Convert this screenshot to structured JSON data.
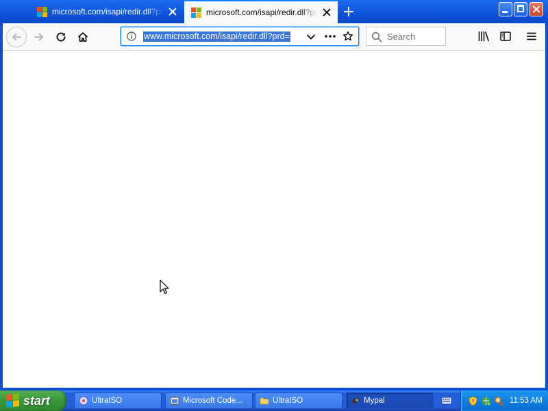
{
  "browser": {
    "tabs": [
      {
        "title": "microsoft.com/isapi/redir.dll?prd=",
        "active": false
      },
      {
        "title": "microsoft.com/isapi/redir.dll?prd=",
        "active": true
      }
    ],
    "url": "www.microsoft.com/isapi/redir.dll?prd=",
    "search_placeholder": "Search",
    "colors": {
      "tabbar": "#0b4fd4",
      "url_highlight": "#3b74d8",
      "focus_ring": "#0a84ff"
    },
    "icons": [
      "back-arrow-icon",
      "forward-arrow-icon",
      "reload-icon",
      "home-icon",
      "info-icon",
      "chevron-down-icon",
      "more-dots-icon",
      "bookmark-star-icon",
      "search-icon",
      "library-icon",
      "sidebar-icon",
      "hamburger-menu-icon"
    ]
  },
  "taskbar": {
    "start_label": "start",
    "items": [
      {
        "label": "UltraISO",
        "icon": "ultraiso-disc-icon"
      },
      {
        "label": "Microsoft Code...",
        "icon": "installer-icon"
      },
      {
        "label": "UltraISO",
        "icon": "folder-icon"
      },
      {
        "label": "Mypal",
        "icon": "mypal-browser-icon",
        "active": true
      }
    ],
    "clock": "11:53 AM"
  }
}
